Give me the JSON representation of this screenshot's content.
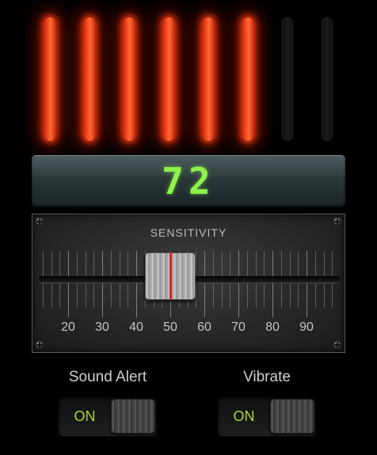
{
  "meter": {
    "levels": [
      true,
      true,
      true,
      true,
      true,
      true,
      false,
      false
    ],
    "on_color": "#ff4a1c",
    "off_color": "#161616"
  },
  "readout": {
    "value": "72",
    "color": "#8df24a"
  },
  "sensitivity": {
    "label": "SENSITIVITY",
    "value": 50,
    "min": 10,
    "max": 100,
    "scale_labels": [
      "20",
      "30",
      "40",
      "50",
      "60",
      "70",
      "80",
      "90"
    ],
    "indicator_color": "#d02a1a"
  },
  "toggles": {
    "sound_alert": {
      "title": "Sound Alert",
      "state": "ON"
    },
    "vibrate": {
      "title": "Vibrate",
      "state": "ON"
    }
  },
  "icons": [
    "screw-icon"
  ]
}
